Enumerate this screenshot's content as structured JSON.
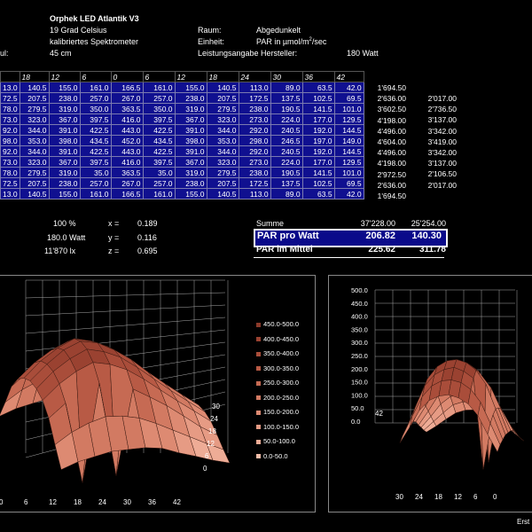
{
  "header": {
    "title": "Orphek LED Atlantik V3",
    "temp": "19 Grad Celsius",
    "device": "kalibriertes Spektrometer",
    "modul_label": "ul:",
    "distance": "45 cm",
    "raum_label": "Raum:",
    "raum_value": "Abgedunkelt",
    "einheit_label": "Einheit:",
    "einheit_value": "PAR in µmol/m",
    "einheit_sup": "2",
    "einheit_tail": "/sec",
    "leistung_label": "Leistungsangabe Hersteller:",
    "leistung_value": "180 Watt"
  },
  "grid": {
    "header": [
      "",
      "18",
      "12",
      "6",
      "0",
      "6",
      "12",
      "18",
      "24",
      "30",
      "36",
      "42"
    ],
    "rows": [
      [
        "13.0",
        "140.5",
        "155.0",
        "161.0",
        "166.5",
        "161.0",
        "155.0",
        "140.5",
        "113.0",
        "89.0",
        "63.5",
        "42.0"
      ],
      [
        "72.5",
        "207.5",
        "238.0",
        "257.0",
        "267.0",
        "257.0",
        "238.0",
        "207.5",
        "172.5",
        "137.5",
        "102.5",
        "69.5"
      ],
      [
        "78.0",
        "279.5",
        "319.0",
        "350.0",
        "363.5",
        "350.0",
        "319.0",
        "279.5",
        "238.0",
        "190.5",
        "141.5",
        "101.0"
      ],
      [
        "73.0",
        "323.0",
        "367.0",
        "397.5",
        "416.0",
        "397.5",
        "367.0",
        "323.0",
        "273.0",
        "224.0",
        "177.0",
        "129.5"
      ],
      [
        "92.0",
        "344.0",
        "391.0",
        "422.5",
        "443.0",
        "422.5",
        "391.0",
        "344.0",
        "292.0",
        "240.5",
        "192.0",
        "144.5"
      ],
      [
        "98.0",
        "353.0",
        "398.0",
        "434.5",
        "452.0",
        "434.5",
        "398.0",
        "353.0",
        "298.0",
        "246.5",
        "197.0",
        "149.0"
      ],
      [
        "92.0",
        "344.0",
        "391.0",
        "422.5",
        "443.0",
        "422.5",
        "391.0",
        "344.0",
        "292.0",
        "240.5",
        "192.0",
        "144.5"
      ],
      [
        "73.0",
        "323.0",
        "367.0",
        "397.5",
        "416.0",
        "397.5",
        "367.0",
        "323.0",
        "273.0",
        "224.0",
        "177.0",
        "129.5"
      ],
      [
        "78.0",
        "279.5",
        "319.0",
        "35.0",
        "363.5",
        "35.0",
        "319.0",
        "279.5",
        "238.0",
        "190.5",
        "141.5",
        "101.0"
      ],
      [
        "72.5",
        "207.5",
        "238.0",
        "257.0",
        "267.0",
        "257.0",
        "238.0",
        "207.5",
        "172.5",
        "137.5",
        "102.5",
        "69.5"
      ],
      [
        "13.0",
        "140.5",
        "155.0",
        "161.0",
        "166.5",
        "161.0",
        "155.0",
        "140.5",
        "113.0",
        "89.0",
        "63.5",
        "42.0"
      ]
    ],
    "sum1": [
      "1'694.50",
      "2'636.00",
      "3'602.50",
      "4'198.00",
      "4'496.00",
      "4'604.00",
      "4'496.00",
      "4'198.00",
      "2'972.50",
      "2'636.00",
      "1'694.50"
    ],
    "sum2": [
      "",
      "2'017.00",
      "2'736.50",
      "3'137.00",
      "3'342.00",
      "3'419.00",
      "3'342.00",
      "3'137.00",
      "2'106.50",
      "2'017.00",
      ""
    ]
  },
  "stats": {
    "pct": "100 %",
    "watt": "180.0  Watt",
    "lx": "11'870  lx",
    "x_label": "x =",
    "x_value": "0.189",
    "y_label": "y =",
    "y_value": "0.116",
    "z_label": "z =",
    "z_value": "0.695"
  },
  "summary": {
    "summe_label": "Summe",
    "summe_1": "37'228.00",
    "summe_2": "25'254.00",
    "par_watt_label": "PAR pro Watt",
    "par_watt_1": "206.82",
    "par_watt_2": "140.30",
    "par_mittel_label": "PAR im Mittel",
    "par_mittel_1": "225.62",
    "par_mittel_2": "311.78"
  },
  "legend": [
    {
      "label": "450.0-500.0",
      "color": "#8b3a2a"
    },
    {
      "label": "400.0-450.0",
      "color": "#9a4231"
    },
    {
      "label": "350.0-400.0",
      "color": "#a94d3a"
    },
    {
      "label": "300.0-350.0",
      "color": "#b85a45"
    },
    {
      "label": "250.0-300.0",
      "color": "#c66a53"
    },
    {
      "label": "200.0-250.0",
      "color": "#d27a62"
    },
    {
      "label": "150.0-200.0",
      "color": "#dd8a72"
    },
    {
      "label": "100.0-150.0",
      "color": "#e69b84"
    },
    {
      "label": "50.0-100.0",
      "color": "#eeac96"
    },
    {
      "label": "0.0-50.0",
      "color": "#f4bea9"
    }
  ],
  "chart1": {
    "x_ticks": [
      "0",
      "6",
      "12",
      "18",
      "24",
      "30",
      "36",
      "42"
    ],
    "y_ticks": [
      "30",
      "24",
      "18",
      "12",
      "6",
      "0"
    ]
  },
  "chart2": {
    "z_ticks": [
      "500.0",
      "450.0",
      "400.0",
      "350.0",
      "300.0",
      "250.0",
      "200.0",
      "150.0",
      "100.0",
      "50.0",
      "0.0"
    ],
    "x_ticks": [
      "30",
      "24",
      "18",
      "12",
      "6",
      "0"
    ],
    "y_ticks": [
      "42"
    ]
  },
  "footer": {
    "text": "Erst"
  }
}
